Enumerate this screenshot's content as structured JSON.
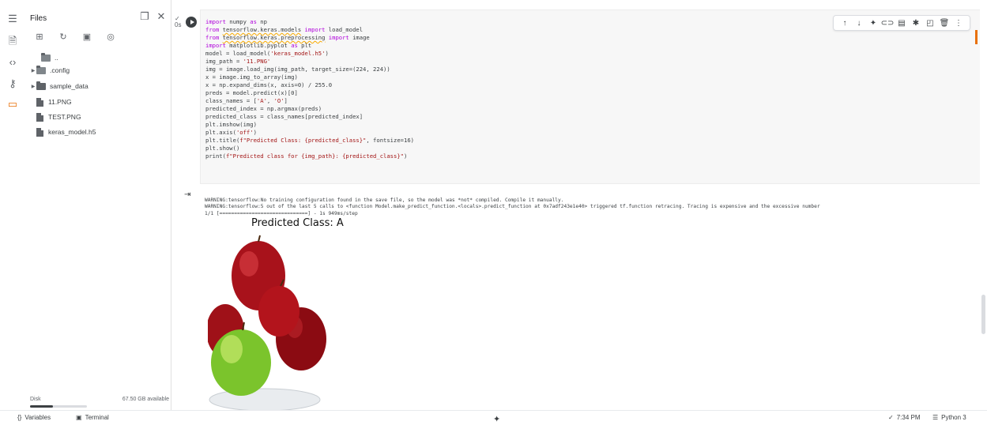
{
  "rail": {
    "icons": [
      "menu-icon",
      "toc-icon",
      "code-icon",
      "key-icon",
      "folder-icon"
    ]
  },
  "files": {
    "title": "Files",
    "tree": [
      {
        "label": "..",
        "type": "folder-up"
      },
      {
        "label": ".config",
        "type": "folder"
      },
      {
        "label": "sample_data",
        "type": "folder"
      },
      {
        "label": "11.PNG",
        "type": "file"
      },
      {
        "label": "TEST.PNG",
        "type": "file"
      },
      {
        "label": "keras_model.h5",
        "type": "file"
      }
    ],
    "disk_label": "Disk",
    "disk_available": "67.50 GB available",
    "disk_used_fraction": 0.4
  },
  "code_lines": [
    "import numpy as np",
    "from tensorflow.keras.models import load_model",
    "from tensorflow.keras.preprocessing import image",
    "import matplotlib.pyplot as plt",
    "model = load_model('keras_model.h5')",
    "img_path = '11.PNG'",
    "img = image.load_img(img_path, target_size=(224, 224))",
    "x = image.img_to_array(img)",
    "x = np.expand_dims(x, axis=0) / 255.0",
    "preds = model.predict(x)[0]",
    "class_names = ['A', 'O']",
    "predicted_index = np.argmax(preds)",
    "predicted_class = class_names[predicted_index]",
    "plt.imshow(img)",
    "plt.axis('off')",
    "plt.title(f\"Predicted Class: {predicted_class}\", fontsize=16)",
    "plt.show()",
    "print(f\"Predicted class for {img_path}: {predicted_class}\")"
  ],
  "output": {
    "lines": [
      "WARNING:tensorflow:No training configuration found in the save file, so the model was *not* compiled. Compile it manually.",
      "WARNING:tensorflow:5 out of the last 5 calls to <function Model.make_predict_function.<locals>.predict_function at 0x7adf243e1e40> triggered tf.function retracing. Tracing is expensive and the excessive number",
      "1/1 [==============================] - 1s 949ms/step"
    ],
    "plot_title": "Predicted Class: A"
  },
  "statusbar": {
    "variables": "Variables",
    "terminal": "Terminal",
    "time": "7:34 PM",
    "runtime": "Python 3"
  },
  "colors": {
    "accent": "#e8710a",
    "keyword": "#af00db",
    "string": "#a31515"
  }
}
